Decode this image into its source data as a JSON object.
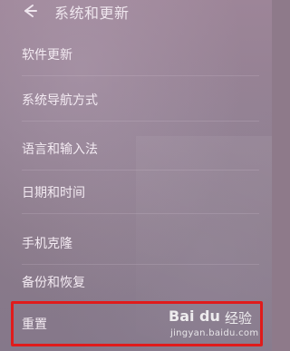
{
  "header": {
    "title": "系统和更新",
    "back_icon": "back-arrow-icon"
  },
  "items": [
    {
      "label": "软件更新"
    },
    {
      "label": "系统导航方式"
    },
    {
      "label": "语言和输入法"
    },
    {
      "label": "日期和时间"
    },
    {
      "label": "手机克隆"
    },
    {
      "label": "备份和恢复"
    },
    {
      "label": "重置"
    }
  ],
  "highlight": {
    "target": "重置",
    "color": "#e01b1b"
  },
  "watermark": {
    "logo_text": "Bai du",
    "brand_cn": "经验",
    "url": "jingyan.baidu.com"
  }
}
